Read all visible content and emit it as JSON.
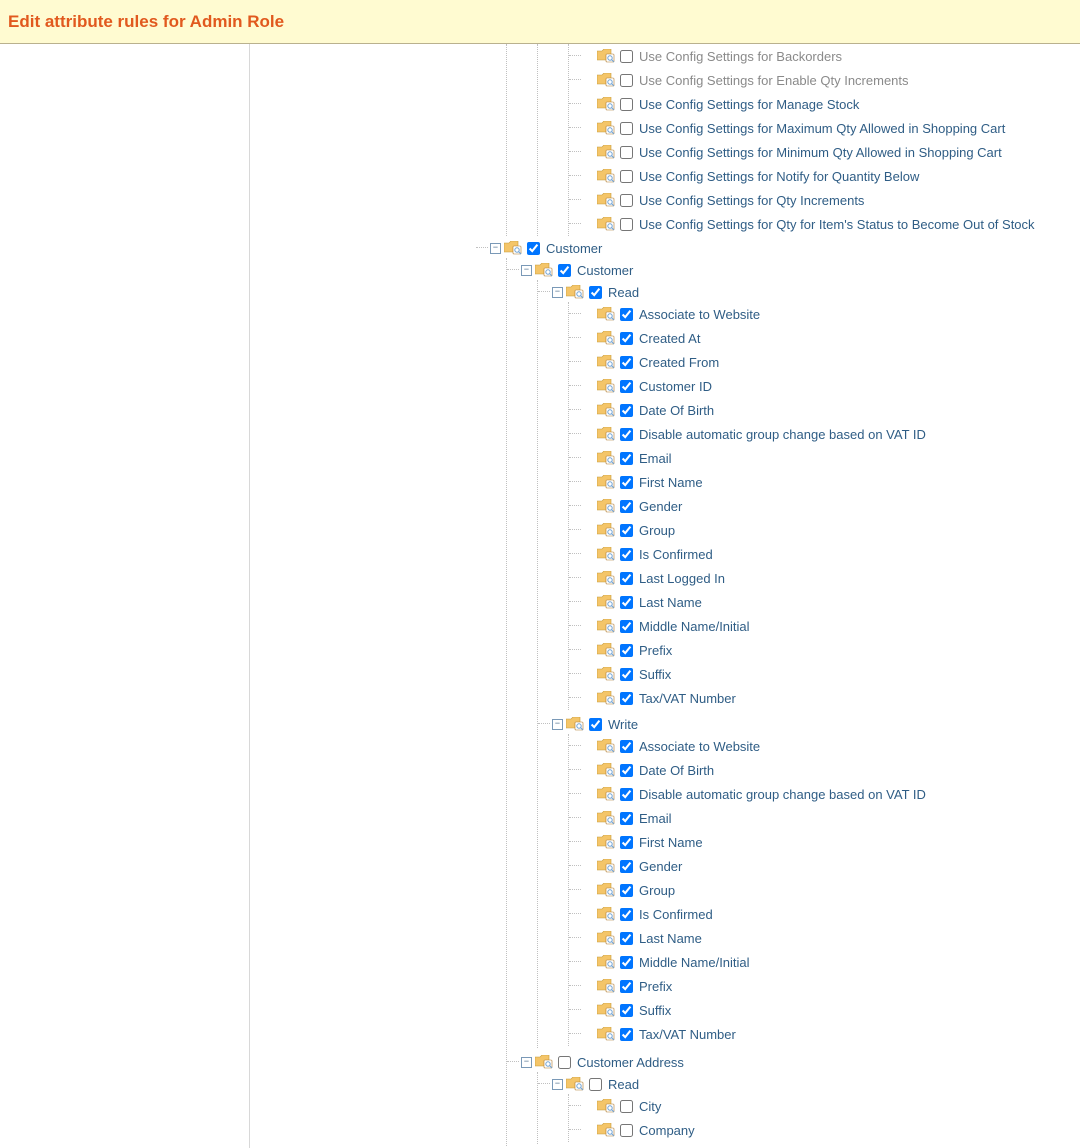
{
  "header": {
    "title": "Edit attribute rules for Admin Role"
  },
  "tree": [
    {
      "id": "cfg-backorders",
      "depth": 3,
      "toggle": "",
      "checked": false,
      "muted": true,
      "label": "Use Config Settings for Backorders"
    },
    {
      "id": "cfg-enable-qty",
      "depth": 3,
      "toggle": "",
      "checked": false,
      "muted": true,
      "label": "Use Config Settings for Enable Qty Increments"
    },
    {
      "id": "cfg-manage-stock",
      "depth": 3,
      "toggle": "",
      "checked": false,
      "muted": false,
      "label": "Use Config Settings for Manage Stock"
    },
    {
      "id": "cfg-max-qty",
      "depth": 3,
      "toggle": "",
      "checked": false,
      "muted": false,
      "label": "Use Config Settings for Maximum Qty Allowed in Shopping Cart"
    },
    {
      "id": "cfg-min-qty",
      "depth": 3,
      "toggle": "",
      "checked": false,
      "muted": false,
      "label": "Use Config Settings for Minimum Qty Allowed in Shopping Cart"
    },
    {
      "id": "cfg-notify-qty",
      "depth": 3,
      "toggle": "",
      "checked": false,
      "muted": false,
      "label": "Use Config Settings for Notify for Quantity Below"
    },
    {
      "id": "cfg-qty-inc",
      "depth": 3,
      "toggle": "",
      "checked": false,
      "muted": false,
      "label": "Use Config Settings for Qty Increments"
    },
    {
      "id": "cfg-qty-oos",
      "depth": 3,
      "toggle": "",
      "checked": false,
      "muted": false,
      "label": "Use Config Settings for Qty for Item's Status to Become Out of Stock"
    },
    {
      "id": "customer-root",
      "depth": 0,
      "toggle": "-",
      "checked": true,
      "muted": false,
      "label": "Customer"
    },
    {
      "id": "customer",
      "depth": 1,
      "toggle": "-",
      "checked": true,
      "muted": false,
      "label": "Customer"
    },
    {
      "id": "cust-read",
      "depth": 2,
      "toggle": "-",
      "checked": true,
      "muted": false,
      "label": "Read"
    },
    {
      "id": "cr-assoc",
      "depth": 3,
      "toggle": "",
      "checked": true,
      "muted": false,
      "label": "Associate to Website"
    },
    {
      "id": "cr-created-at",
      "depth": 3,
      "toggle": "",
      "checked": true,
      "muted": false,
      "label": "Created At"
    },
    {
      "id": "cr-created-from",
      "depth": 3,
      "toggle": "",
      "checked": true,
      "muted": false,
      "label": "Created From"
    },
    {
      "id": "cr-cust-id",
      "depth": 3,
      "toggle": "",
      "checked": true,
      "muted": false,
      "label": "Customer ID"
    },
    {
      "id": "cr-dob",
      "depth": 3,
      "toggle": "",
      "checked": true,
      "muted": false,
      "label": "Date Of Birth"
    },
    {
      "id": "cr-disable-vat",
      "depth": 3,
      "toggle": "",
      "checked": true,
      "muted": false,
      "label": "Disable automatic group change based on VAT ID"
    },
    {
      "id": "cr-email",
      "depth": 3,
      "toggle": "",
      "checked": true,
      "muted": false,
      "label": "Email"
    },
    {
      "id": "cr-first",
      "depth": 3,
      "toggle": "",
      "checked": true,
      "muted": false,
      "label": "First Name"
    },
    {
      "id": "cr-gender",
      "depth": 3,
      "toggle": "",
      "checked": true,
      "muted": false,
      "label": "Gender"
    },
    {
      "id": "cr-group",
      "depth": 3,
      "toggle": "",
      "checked": true,
      "muted": false,
      "label": "Group"
    },
    {
      "id": "cr-confirmed",
      "depth": 3,
      "toggle": "",
      "checked": true,
      "muted": false,
      "label": "Is Confirmed"
    },
    {
      "id": "cr-last-login",
      "depth": 3,
      "toggle": "",
      "checked": true,
      "muted": false,
      "label": "Last Logged In"
    },
    {
      "id": "cr-last",
      "depth": 3,
      "toggle": "",
      "checked": true,
      "muted": false,
      "label": "Last Name"
    },
    {
      "id": "cr-middle",
      "depth": 3,
      "toggle": "",
      "checked": true,
      "muted": false,
      "label": "Middle Name/Initial"
    },
    {
      "id": "cr-prefix",
      "depth": 3,
      "toggle": "",
      "checked": true,
      "muted": false,
      "label": "Prefix"
    },
    {
      "id": "cr-suffix",
      "depth": 3,
      "toggle": "",
      "checked": true,
      "muted": false,
      "label": "Suffix"
    },
    {
      "id": "cr-tax",
      "depth": 3,
      "toggle": "",
      "checked": true,
      "muted": false,
      "label": "Tax/VAT Number"
    },
    {
      "id": "cust-write",
      "depth": 2,
      "toggle": "-",
      "checked": true,
      "muted": false,
      "label": "Write"
    },
    {
      "id": "cw-assoc",
      "depth": 3,
      "toggle": "",
      "checked": true,
      "muted": false,
      "label": "Associate to Website"
    },
    {
      "id": "cw-dob",
      "depth": 3,
      "toggle": "",
      "checked": true,
      "muted": false,
      "label": "Date Of Birth"
    },
    {
      "id": "cw-disable-vat",
      "depth": 3,
      "toggle": "",
      "checked": true,
      "muted": false,
      "label": "Disable automatic group change based on VAT ID"
    },
    {
      "id": "cw-email",
      "depth": 3,
      "toggle": "",
      "checked": true,
      "muted": false,
      "label": "Email"
    },
    {
      "id": "cw-first",
      "depth": 3,
      "toggle": "",
      "checked": true,
      "muted": false,
      "label": "First Name"
    },
    {
      "id": "cw-gender",
      "depth": 3,
      "toggle": "",
      "checked": true,
      "muted": false,
      "label": "Gender"
    },
    {
      "id": "cw-group",
      "depth": 3,
      "toggle": "",
      "checked": true,
      "muted": false,
      "label": "Group"
    },
    {
      "id": "cw-confirmed",
      "depth": 3,
      "toggle": "",
      "checked": true,
      "muted": false,
      "label": "Is Confirmed"
    },
    {
      "id": "cw-last",
      "depth": 3,
      "toggle": "",
      "checked": true,
      "muted": false,
      "label": "Last Name"
    },
    {
      "id": "cw-middle",
      "depth": 3,
      "toggle": "",
      "checked": true,
      "muted": false,
      "label": "Middle Name/Initial"
    },
    {
      "id": "cw-prefix",
      "depth": 3,
      "toggle": "",
      "checked": true,
      "muted": false,
      "label": "Prefix"
    },
    {
      "id": "cw-suffix",
      "depth": 3,
      "toggle": "",
      "checked": true,
      "muted": false,
      "label": "Suffix"
    },
    {
      "id": "cw-tax",
      "depth": 3,
      "toggle": "",
      "checked": true,
      "muted": false,
      "label": "Tax/VAT Number"
    },
    {
      "id": "cust-addr",
      "depth": 1,
      "toggle": "-",
      "checked": false,
      "muted": false,
      "label": "Customer Address"
    },
    {
      "id": "ca-read",
      "depth": 2,
      "toggle": "-",
      "checked": false,
      "muted": false,
      "label": "Read"
    },
    {
      "id": "car-city",
      "depth": 3,
      "toggle": "",
      "checked": false,
      "muted": false,
      "label": "City"
    },
    {
      "id": "car-company",
      "depth": 3,
      "toggle": "",
      "checked": false,
      "muted": false,
      "label": "Company"
    }
  ]
}
